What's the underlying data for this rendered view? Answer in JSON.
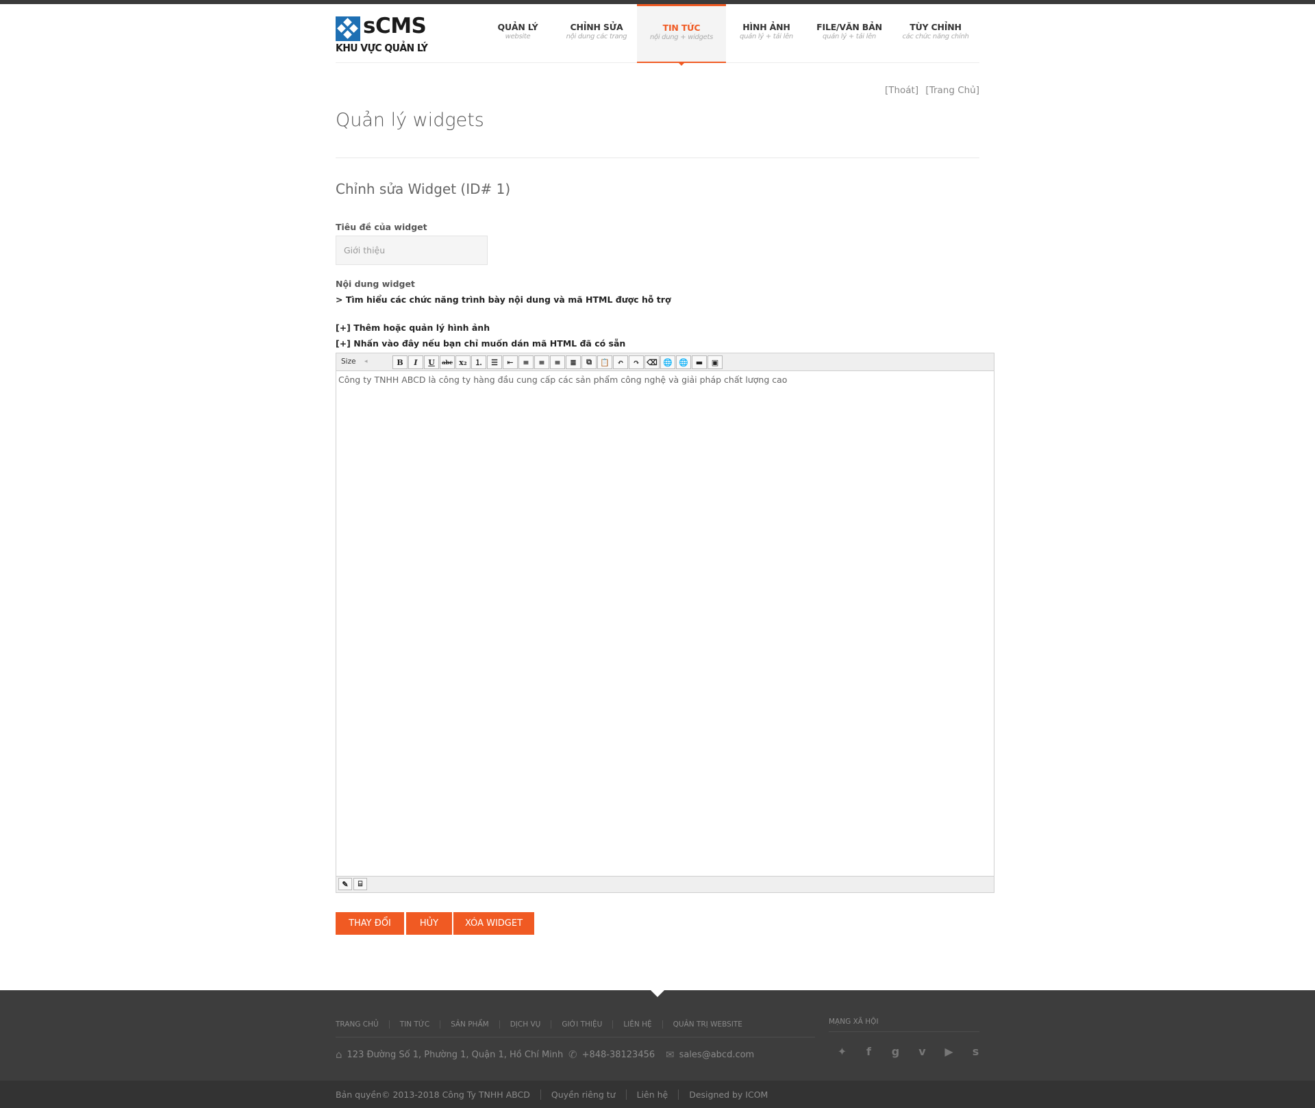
{
  "header": {
    "logo_title": "sCMS",
    "logo_subtitle": "KHU VỰC QUẢN LÝ",
    "nav": [
      {
        "title": "QUẢN LÝ",
        "sub": "website"
      },
      {
        "title": "CHỈNH SỬA",
        "sub": "nội dung các trang"
      },
      {
        "title": "TIN TỨC",
        "sub": "nội dung + widgets"
      },
      {
        "title": "HÌNH ẢNH",
        "sub": "quản lý + tải lên"
      },
      {
        "title": "FILE/VĂN BẢN",
        "sub": "quản lý + tải lên"
      },
      {
        "title": "TÙY CHỈNH",
        "sub": "các chức năng chính"
      }
    ],
    "active_nav": "TIN TỨC",
    "accent_color": "#f05a23"
  },
  "top_links": {
    "logout": "[Thoát]",
    "home": "[Trang Chủ]"
  },
  "page": {
    "title": "Quản lý widgets",
    "subtitle": "Chỉnh sửa Widget (ID# 1)"
  },
  "form": {
    "title_label": "Tiêu đề của widget",
    "title_value": "Giới thiệu",
    "content_label": "Nội dung widget",
    "help_link": "> Tìm hiểu các chức năng trình bày nội dung và mã HTML được hỗ trợ",
    "images_link": "[+] Thêm hoặc quản lý hình ảnh",
    "paste_link": "[+] Nhấn vào đây nếu bạn chỉ muốn dán mã HTML đã có sẵn"
  },
  "editor": {
    "size_label": "Size",
    "size_value": "◂",
    "toolbar": [
      {
        "name": "bold-button",
        "glyph": "B"
      },
      {
        "name": "italic-button",
        "glyph": "I"
      },
      {
        "name": "underline-button",
        "glyph": "U"
      },
      {
        "name": "strikethrough-button",
        "glyph": "abc"
      },
      {
        "name": "subscript-button",
        "glyph": "x₂"
      },
      {
        "name": "ordered-list-button",
        "glyph": "⒈"
      },
      {
        "name": "unordered-list-button",
        "glyph": "☰"
      },
      {
        "name": "outdent-button",
        "glyph": "⇤"
      },
      {
        "name": "align-left-button",
        "glyph": "≡"
      },
      {
        "name": "align-center-button",
        "glyph": "≡"
      },
      {
        "name": "align-right-button",
        "glyph": "≡"
      },
      {
        "name": "justify-button",
        "glyph": "≣"
      },
      {
        "name": "copy-button",
        "glyph": "⧉"
      },
      {
        "name": "paste-button",
        "glyph": "📋"
      },
      {
        "name": "undo-button",
        "glyph": "↶"
      },
      {
        "name": "redo-button",
        "glyph": "↷"
      },
      {
        "name": "eraser-button",
        "glyph": "⌫"
      },
      {
        "name": "link-button",
        "glyph": "🌐"
      },
      {
        "name": "unlink-button",
        "glyph": "🌐"
      },
      {
        "name": "horizontal-rule-button",
        "glyph": "▬"
      },
      {
        "name": "image-button",
        "glyph": "▣"
      }
    ],
    "content": "Công ty TNHH ABCD là công ty hàng đầu cung cấp các sản phẩm công nghệ và giải pháp chất lượng cao",
    "footer_buttons": [
      {
        "name": "design-mode-icon",
        "glyph": "✎"
      },
      {
        "name": "html-mode-icon",
        "glyph": "⌸"
      }
    ]
  },
  "buttons": {
    "save": "THAY ĐỔI",
    "cancel": "HỦY",
    "delete": "XÓA WIDGET"
  },
  "footer": {
    "nav": [
      "TRANG CHỦ",
      "TIN TỨC",
      "SẢN PHẨM",
      "DỊCH VỤ",
      "GIỚI THIỆU",
      "LIÊN HỆ",
      "QUẢN TRỊ WEBSITE"
    ],
    "address": "123 Đường Số 1, Phường 1, Quận 1, Hồ Chí Minh",
    "phone": "+848-38123456",
    "email": "sales@abcd.com",
    "social_heading": "MẠNG XÃ HỘI",
    "socials": [
      "twitter-icon",
      "facebook-icon",
      "google-plus-icon",
      "vimeo-icon",
      "youtube-icon",
      "skype-icon"
    ],
    "copyright": "Bản quyền© 2013-2018 Công Ty TNHH ABCD",
    "privacy": "Quyền riêng tư",
    "contact": "Liên hệ",
    "designed_by": "Designed by ICOM"
  }
}
